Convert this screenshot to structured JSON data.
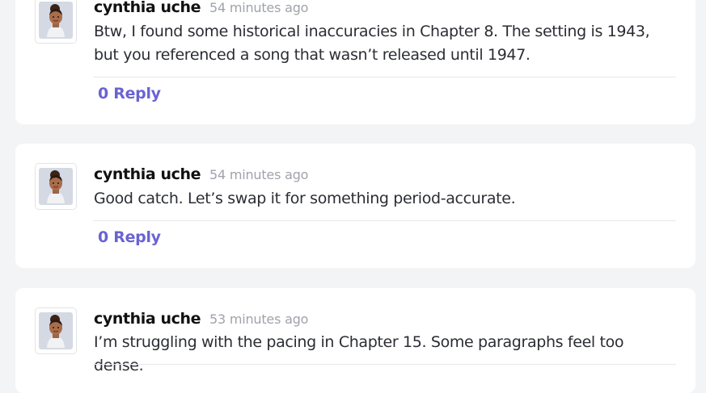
{
  "comments": [
    {
      "author": "cynthia uche",
      "time": "54 minutes ago",
      "text": "Btw, I found some historical inaccuracies in Chapter 8. The setting is 1943, but you referenced a song that wasn’t released until 1947.",
      "reply_label": "0 Reply"
    },
    {
      "author": "cynthia uche",
      "time": "54 minutes ago",
      "text": "Good catch. Let’s swap it for something period-accurate.",
      "reply_label": "0 Reply"
    },
    {
      "author": "cynthia uche",
      "time": "53 minutes ago",
      "text": "I’m struggling with the pacing in Chapter 15. Some paragraphs feel too dense."
    }
  ],
  "colors": {
    "accent": "#6a63d2",
    "background": "#f3f4f6",
    "card": "#ffffff"
  }
}
